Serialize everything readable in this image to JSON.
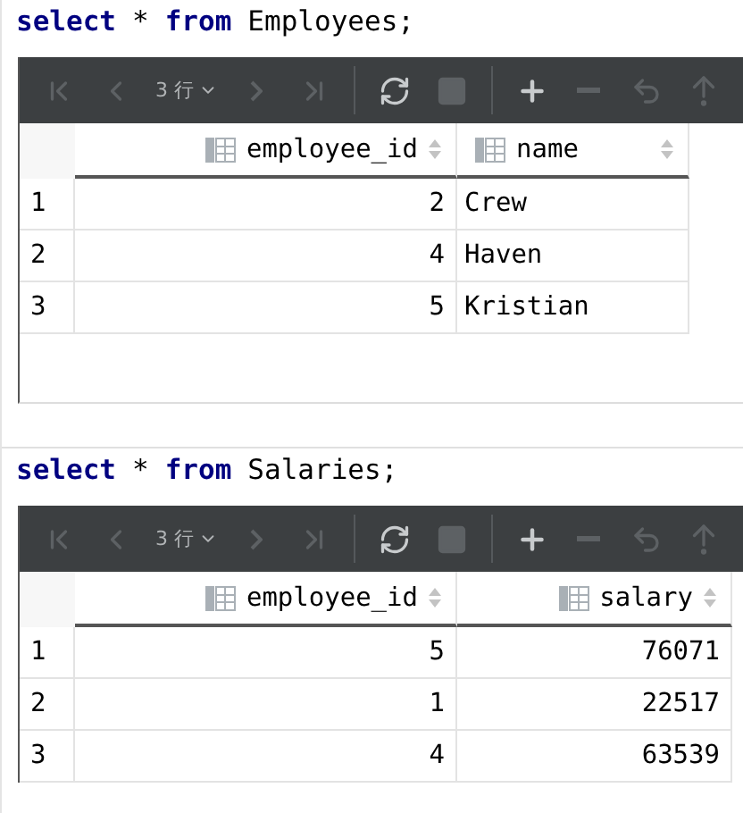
{
  "results": [
    {
      "query": [
        {
          "text": "select",
          "kind": "keyword"
        },
        {
          "text": "*",
          "kind": "operator"
        },
        {
          "text": "from",
          "kind": "keyword"
        },
        {
          "text": "Employees;",
          "kind": "identifier"
        }
      ],
      "toolbar": {
        "row_count": "3 行",
        "buttons": [
          {
            "kind": "first",
            "disabled": true
          },
          {
            "kind": "previous",
            "disabled": true
          },
          {
            "kind": "rows"
          },
          {
            "kind": "next",
            "disabled": true
          },
          {
            "kind": "last",
            "disabled": true
          },
          {
            "kind": "separator"
          },
          {
            "kind": "refresh",
            "disabled": false
          },
          {
            "kind": "stop",
            "disabled": true
          },
          {
            "kind": "separator"
          },
          {
            "kind": "add",
            "disabled": false
          },
          {
            "kind": "remove",
            "disabled": true
          },
          {
            "kind": "revert",
            "disabled": true
          },
          {
            "kind": "submit",
            "disabled": true
          }
        ]
      },
      "columns": [
        {
          "name": "employee_id",
          "kind": "number"
        },
        {
          "name": "name",
          "kind": "text"
        }
      ],
      "rows": [
        {
          "number": "1",
          "cells": [
            "2",
            "Crew"
          ]
        },
        {
          "number": "2",
          "cells": [
            "4",
            "Haven"
          ]
        },
        {
          "number": "3",
          "cells": [
            "5",
            "Kristian"
          ]
        }
      ]
    },
    {
      "query": [
        {
          "text": "select",
          "kind": "keyword"
        },
        {
          "text": "*",
          "kind": "operator"
        },
        {
          "text": "from",
          "kind": "keyword"
        },
        {
          "text": "Salaries;",
          "kind": "identifier"
        }
      ],
      "toolbar": {
        "row_count": "3 行",
        "buttons": [
          {
            "kind": "first",
            "disabled": true
          },
          {
            "kind": "previous",
            "disabled": true
          },
          {
            "kind": "rows"
          },
          {
            "kind": "next",
            "disabled": true
          },
          {
            "kind": "last",
            "disabled": true
          },
          {
            "kind": "separator"
          },
          {
            "kind": "refresh",
            "disabled": false
          },
          {
            "kind": "stop",
            "disabled": true
          },
          {
            "kind": "separator"
          },
          {
            "kind": "add",
            "disabled": false
          },
          {
            "kind": "remove",
            "disabled": true
          },
          {
            "kind": "revert",
            "disabled": true
          },
          {
            "kind": "submit",
            "disabled": true
          }
        ]
      },
      "columns": [
        {
          "name": "employee_id",
          "kind": "number"
        },
        {
          "name": "salary",
          "kind": "number"
        }
      ],
      "rows": [
        {
          "number": "1",
          "cells": [
            "5",
            "76071"
          ]
        },
        {
          "number": "2",
          "cells": [
            "1",
            "22517"
          ]
        },
        {
          "number": "3",
          "cells": [
            "4",
            "63539"
          ]
        }
      ]
    }
  ]
}
